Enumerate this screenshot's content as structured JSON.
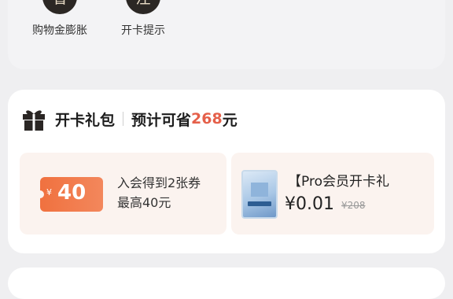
{
  "benefits": [
    {
      "glyph": "省",
      "label": "购物金膨胀"
    },
    {
      "glyph": "注",
      "label": "开卡提示"
    }
  ],
  "gift_section": {
    "icon": "gift-icon",
    "title": "开卡礼包",
    "save_prefix": "预计可省",
    "save_amount": "268",
    "save_unit": "元"
  },
  "coupon_item": {
    "currency": "¥",
    "value": "40",
    "line1": "入会得到2张券",
    "line2": "最高40元"
  },
  "product_item": {
    "title": "【Pro会员开卡礼",
    "price": "¥0.01",
    "original_price": "¥208"
  },
  "colors": {
    "accent": "#e5604a",
    "circle_bg": "#2b2724",
    "item_bg": "#fbf3ef"
  }
}
